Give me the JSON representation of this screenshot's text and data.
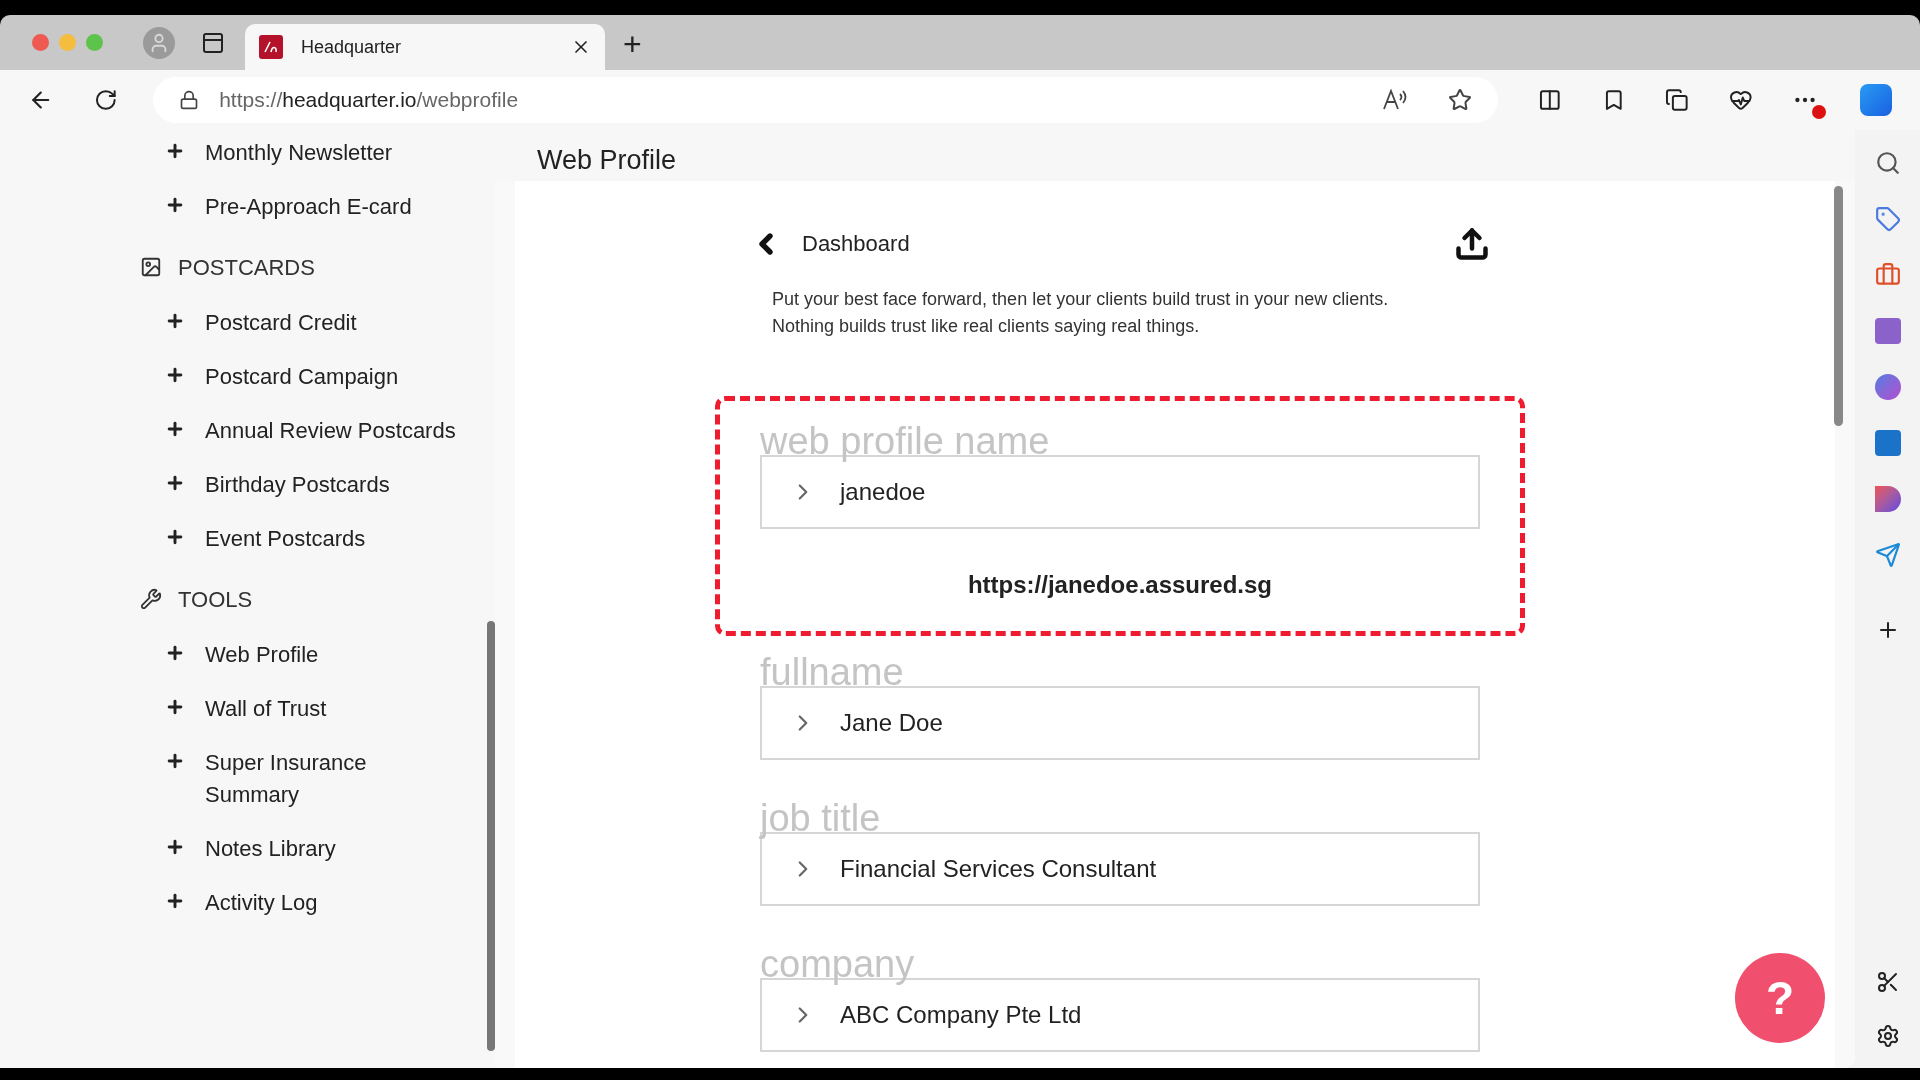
{
  "browser": {
    "tab_title": "Headquarter",
    "new_tab": "+",
    "url": {
      "scheme": "https://",
      "domain": "headquarter.io",
      "path": "/webprofile"
    }
  },
  "sidebar": {
    "items": [
      {
        "kind": "item",
        "label": "Monthly Newsletter"
      },
      {
        "kind": "item",
        "label": "Pre-Approach E-card"
      },
      {
        "kind": "section",
        "label": "POSTCARDS"
      },
      {
        "kind": "item",
        "label": "Postcard Credit"
      },
      {
        "kind": "item",
        "label": "Postcard Campaign"
      },
      {
        "kind": "item",
        "label": "Annual Review Postcards"
      },
      {
        "kind": "item",
        "label": "Birthday Postcards"
      },
      {
        "kind": "item",
        "label": "Event Postcards"
      },
      {
        "kind": "section",
        "label": "TOOLS"
      },
      {
        "kind": "item",
        "label": "Web Profile"
      },
      {
        "kind": "item",
        "label": "Wall of Trust"
      },
      {
        "kind": "item",
        "label": "Super Insurance Summary"
      },
      {
        "kind": "item",
        "label": "Notes Library"
      },
      {
        "kind": "item",
        "label": "Activity Log"
      }
    ]
  },
  "page": {
    "title": "Web Profile",
    "back_label": "Dashboard",
    "intro": "Put your best face forward, then let your clients build trust in your new clients. Nothing builds trust like real clients saying real things.",
    "fields": [
      {
        "label": "web profile name",
        "value": "janedoe",
        "highlighted": true,
        "link": "https://janedoe.assured.sg"
      },
      {
        "label": "fullname",
        "value": "Jane Doe",
        "highlighted": false
      },
      {
        "label": "job title",
        "value": "Financial Services Consultant",
        "highlighted": false
      },
      {
        "label": "company",
        "value": "ABC Company Pte Ltd",
        "highlighted": false
      }
    ]
  },
  "help_button": "?"
}
